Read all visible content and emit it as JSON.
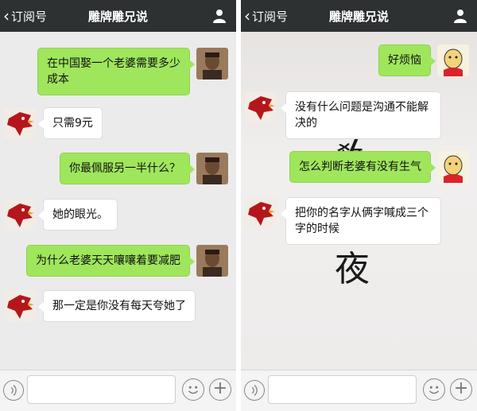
{
  "left": {
    "header": {
      "back_label": "订阅号",
      "title": "雕牌雕兄说"
    },
    "messages": [
      {
        "from": "me",
        "text": "在中国娶一个老婆需要多少成本"
      },
      {
        "from": "them",
        "text": "只需9元"
      },
      {
        "from": "me",
        "text": "你最佩服另一半什么？"
      },
      {
        "from": "them",
        "text": "她的眼光。"
      },
      {
        "from": "me",
        "text": "为什么老婆天天嚷嚷着要减肥"
      },
      {
        "from": "them",
        "text": "那一定是你没有每天夸她了"
      }
    ]
  },
  "right": {
    "header": {
      "back_label": "订阅号",
      "title": "雕牌雕兄说"
    },
    "messages": [
      {
        "from": "me",
        "text": "好烦恼"
      },
      {
        "from": "them",
        "text": "没有什么问题是沟通不能解决的"
      },
      {
        "from": "me",
        "text": "怎么判断老婆有没有生气"
      },
      {
        "from": "them",
        "text": "把你的名字从俩字喊成三个字的时候"
      }
    ],
    "background_calligraphy": [
      "敎",
      "夜"
    ]
  },
  "icons": {
    "back": "chevron-left-icon",
    "profile": "person-icon",
    "voice": "voice-icon",
    "emoji": "emoji-icon",
    "more": "plus-icon"
  },
  "colors": {
    "header": "#2e3132",
    "my_bubble": "#9fe65c",
    "their_bubble": "#ffffff",
    "chat_bg": "#ebebeb"
  }
}
